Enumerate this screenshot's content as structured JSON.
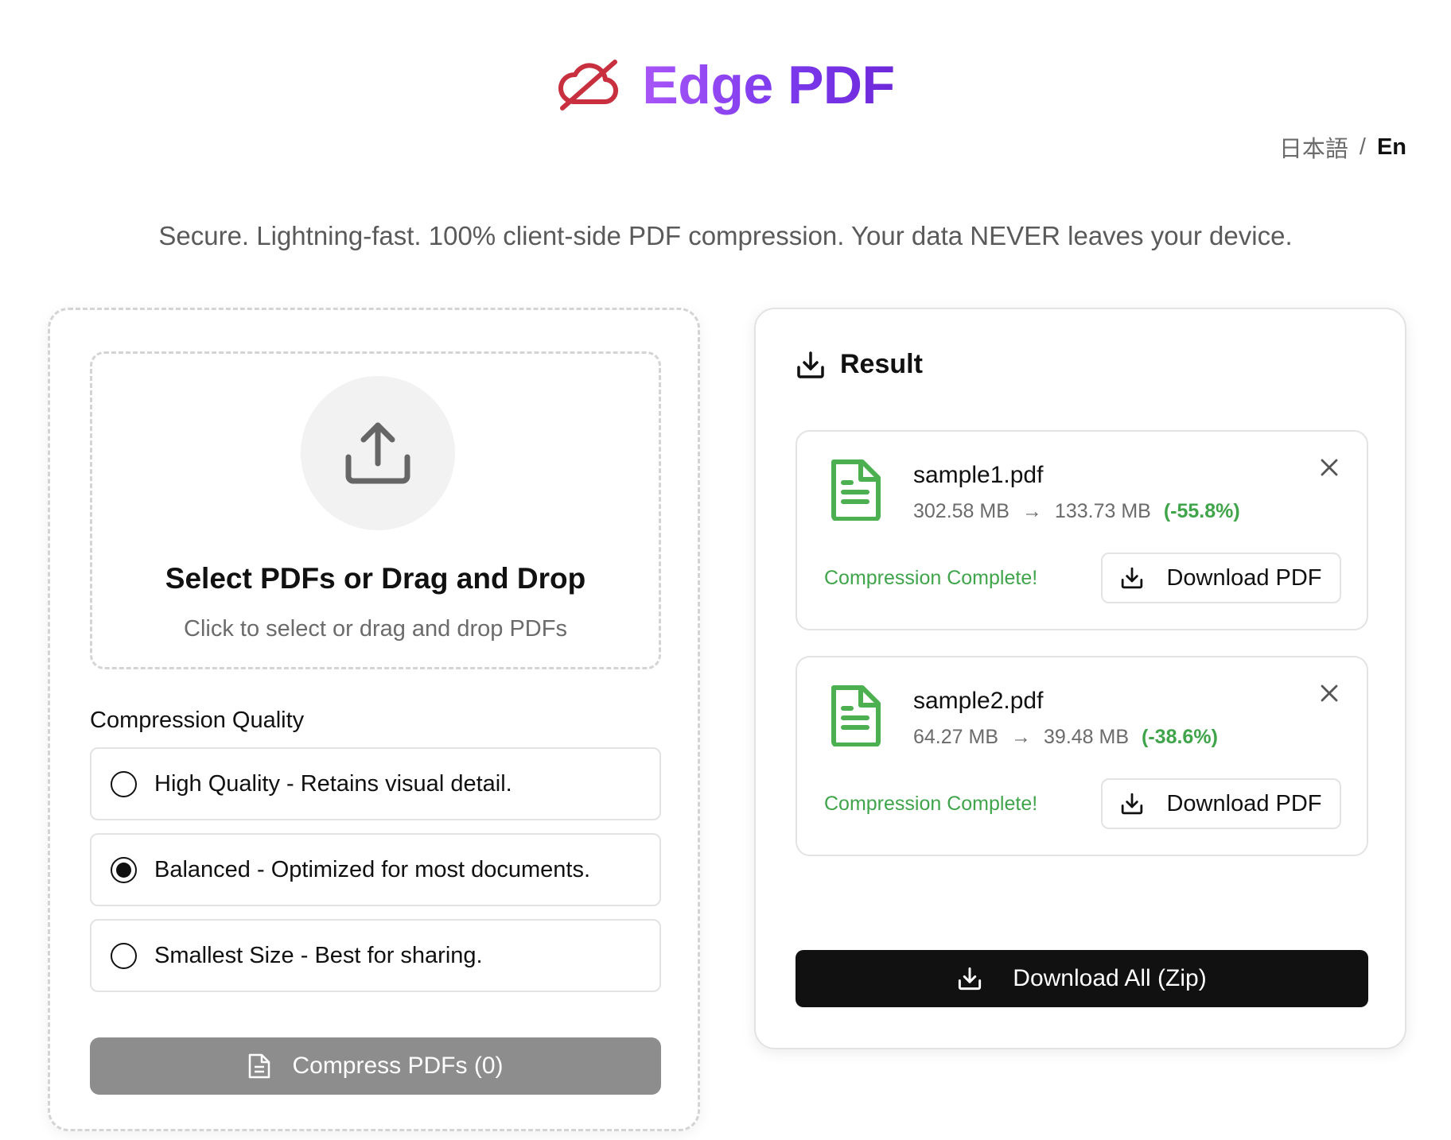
{
  "app": {
    "title": "Edge PDF",
    "logo_icon": "cloud-off-icon",
    "brand_gradient": [
      "#a855f7",
      "#6d28d9"
    ],
    "logo_color": "#c8303f"
  },
  "language": {
    "ja": "日本語",
    "separator": "/",
    "en": "En"
  },
  "tagline": "Secure. Lightning-fast. 100% client-side PDF compression. Your data NEVER leaves your device.",
  "upload": {
    "icon": "upload-icon",
    "title": "Select PDFs or Drag and Drop",
    "subtitle": "Click to select or drag and drop PDFs"
  },
  "quality": {
    "heading": "Compression Quality",
    "options": [
      {
        "label": "High Quality - Retains visual detail.",
        "selected": false
      },
      {
        "label": "Balanced - Optimized for most documents.",
        "selected": true
      },
      {
        "label": "Smallest Size - Best for sharing.",
        "selected": false
      }
    ]
  },
  "compress_button": {
    "label": "Compress PDFs (0)",
    "icon": "document-icon"
  },
  "result": {
    "title": "Result",
    "icon": "download-icon",
    "files": [
      {
        "name": "sample1.pdf",
        "original_size": "302.58 MB",
        "arrow": "→",
        "compressed_size": "133.73 MB",
        "reduction": "(-55.8%)",
        "status": "Compression Complete!",
        "download_label": "Download PDF"
      },
      {
        "name": "sample2.pdf",
        "original_size": "64.27 MB",
        "arrow": "→",
        "compressed_size": "39.48 MB",
        "reduction": "(-38.6%)",
        "status": "Compression Complete!",
        "download_label": "Download PDF"
      }
    ],
    "download_all_label": "Download All (Zip)"
  },
  "colors": {
    "success": "#3fa44a",
    "primary_dark": "#111111",
    "disabled": "#8d8d8d"
  }
}
